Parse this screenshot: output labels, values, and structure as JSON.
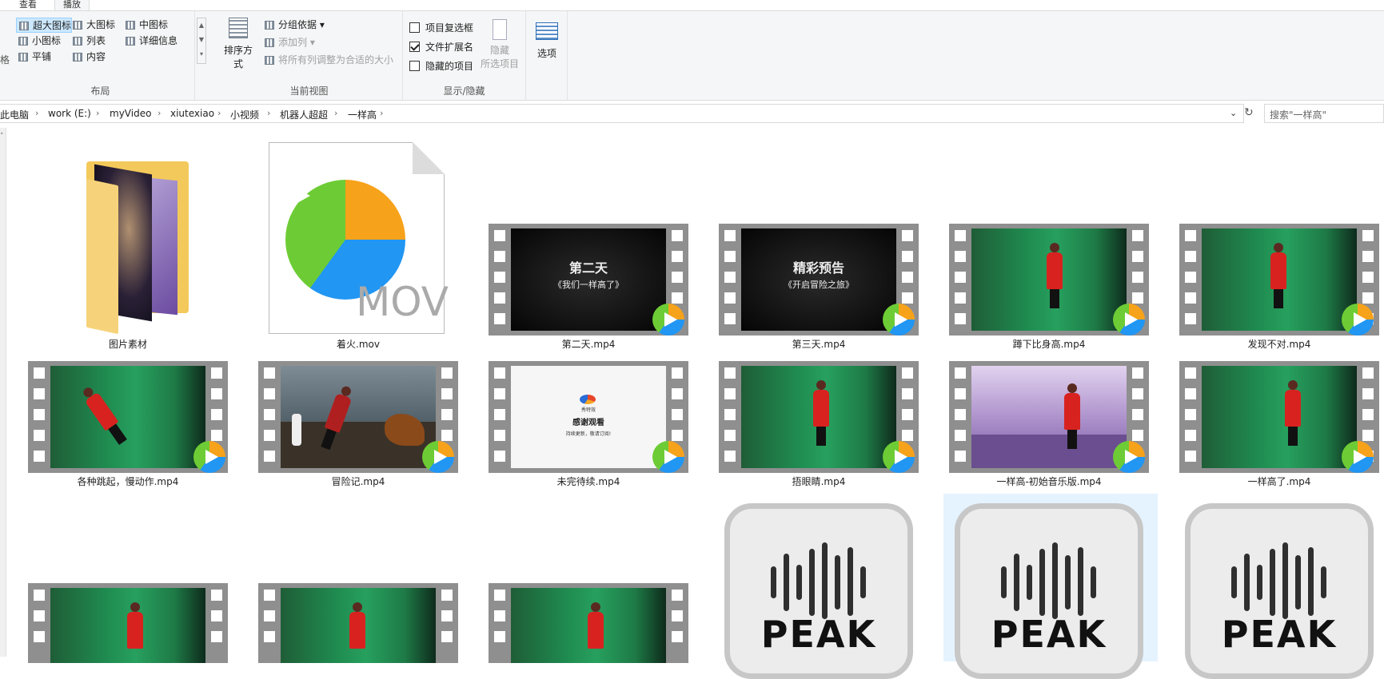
{
  "ribbon_tabs": [
    "查看",
    "播放"
  ],
  "ribbon": {
    "layout": {
      "label": "布局",
      "items": [
        "超大图标",
        "大图标",
        "中图标",
        "小图标",
        "列表",
        "详细信息",
        "平铺",
        "内容"
      ]
    },
    "current_view": {
      "label": "当前视图",
      "sort": "排序方式",
      "group_by": "分组依据",
      "add_column": "添加列",
      "fit_columns": "将所有列调整为合适的大小"
    },
    "show_hide": {
      "label": "显示/隐藏",
      "item_checkbox": "项目复选框",
      "item_checkbox_checked": false,
      "file_ext": "文件扩展名",
      "file_ext_checked": true,
      "hidden_items": "隐藏的项目",
      "hidden_items_checked": false,
      "hide": "隐藏",
      "hide_sub": "所选项目"
    },
    "options": "选项",
    "left_cut": "格"
  },
  "address": {
    "crumbs": [
      "此电脑",
      "work (E:)",
      "myVideo",
      "xiutexiao",
      "小视频",
      "机器人超超",
      "一样高"
    ],
    "search_placeholder": "搜索\"一样高\""
  },
  "files": {
    "f1": "图片素材",
    "f2": "着火.mov",
    "f3": "第二天.mp4",
    "f4": "第三天.mp4",
    "f5": "蹲下比身高.mp4",
    "f6": "发现不对.mp4",
    "f7": "各种跳起，慢动作.mp4",
    "f8": "冒险记.mp4",
    "f9": "未完待续.mp4",
    "f10": "捂眼睛.mp4",
    "f11": "一样高-初始音乐版.mp4",
    "f12": "一样高了.mp4"
  },
  "thumb_text": {
    "day2_title": "第二天",
    "day2_sub": "《我们一样高了》",
    "day3_title": "精彩预告",
    "day3_sub": "《开启冒险之旅》",
    "end_logo": "秀特效",
    "end_title": "感谢观看",
    "end_sub": "持续更新，敬请订阅!",
    "mov_ext": "MOV",
    "peak": "PEAK"
  },
  "colors": {
    "selection": "#cce8ff",
    "ribbon_bg": "#f5f6f7",
    "play_orange": "#f7a21b",
    "play_blue": "#2196f3",
    "play_green": "#6dcc35"
  }
}
